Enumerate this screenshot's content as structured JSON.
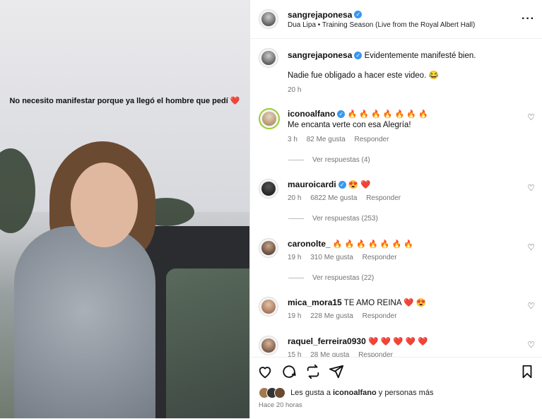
{
  "media": {
    "caption": "No necesito manifestar porque ya llegó el hombre que pedí ❤️"
  },
  "header": {
    "username": "sangrejaponesa",
    "audio": "Dua Lipa • Training Season (Live from the Royal Albert Hall)",
    "more_label": "···"
  },
  "post": {
    "username": "sangrejaponesa",
    "text1": "Evidentemente manifesté bien.",
    "text2": "Nadie fue obligado a hacer este video. 😂",
    "time": "20 h"
  },
  "comments": [
    {
      "username": "iconoalfano",
      "text": "🔥 🔥 🔥 🔥 🔥 🔥 🔥",
      "second_line": "Me encanta verte con esa Alegría!",
      "time": "3 h",
      "likes": "82 Me gusta",
      "reply": "Responder",
      "replies": "Ver respuestas (4)"
    },
    {
      "username": "mauroicardi",
      "text": "😍 ❤️",
      "time": "20 h",
      "likes": "6822 Me gusta",
      "reply": "Responder",
      "replies": "Ver respuestas (253)"
    },
    {
      "username": "caronolte_",
      "text": "🔥 🔥 🔥 🔥 🔥 🔥 🔥",
      "time": "19 h",
      "likes": "310 Me gusta",
      "reply": "Responder",
      "replies": "Ver respuestas (22)"
    },
    {
      "username": "mica_mora15",
      "text": "TE AMO REINA ❤️ 😍",
      "time": "19 h",
      "likes": "228 Me gusta",
      "reply": "Responder"
    },
    {
      "username": "raquel_ferreira0930",
      "text": "❤️ ❤️ ❤️ ❤️ ❤️",
      "time": "15 h",
      "likes": "28 Me gusta",
      "reply": "Responder"
    }
  ],
  "footer": {
    "likes_prefix": "Les gusta a",
    "likes_user": "iconoalfano",
    "likes_suffix": "y personas más",
    "posted": "Hace 20 horas"
  },
  "icons": {
    "verified": "✓",
    "heart_outline": "♡"
  }
}
